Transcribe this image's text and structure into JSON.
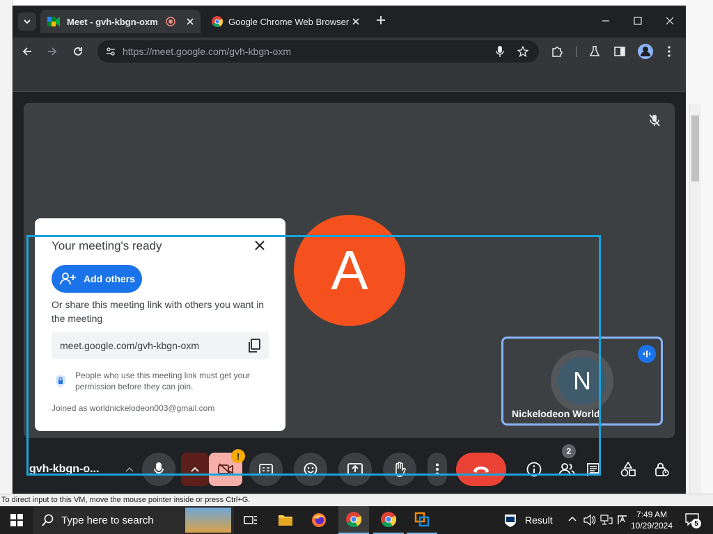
{
  "vm": {
    "status_text": "To direct input to this VM, move the mouse pointer inside or press Ctrl+G."
  },
  "tabs": [
    {
      "title": "Meet - gvh-kbgn-oxm"
    },
    {
      "title": "Google Chrome Web Browser"
    }
  ],
  "omnibox": {
    "url": "https://meet.google.com/gvh-kbgn-oxm"
  },
  "meet": {
    "main_avatar_letter": "A",
    "main_avatar_color": "#f4511e",
    "popup": {
      "title": "Your meeting's ready",
      "add_others_label": "Add others",
      "share_text": "Or share this meeting link with others you want in the meeting",
      "link": "meet.google.com/gvh-kbgn-oxm",
      "permission_text": "People who use this meeting link must get your permission before they can join.",
      "joined_as": "Joined as worldnickelodeon003@gmail.com"
    },
    "self_tile": {
      "letter": "N",
      "name": "Nickelodeon World"
    },
    "meeting_code": "gvh-kbgn-o...",
    "camera_warning": "!",
    "people_count": "2",
    "accent_color": "#1a73e8",
    "end_call_color": "#ea4335"
  },
  "taskbar": {
    "search_placeholder": "Type here to search",
    "result_label": "Result",
    "time": "7:49 AM",
    "date": "10/29/2024",
    "notification_count": "5"
  }
}
